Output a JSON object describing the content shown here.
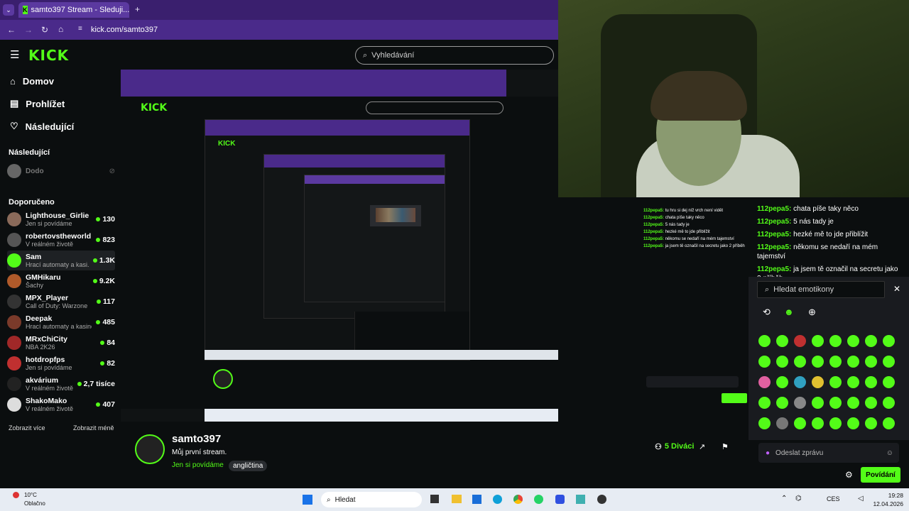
{
  "browser": {
    "tab_title": "samto397 Stream - Sleduji...",
    "url": "kick.com/samto397"
  },
  "header": {
    "logo": "KICK",
    "search_placeholder": "Vyhledávání"
  },
  "sidebar": {
    "nav": [
      {
        "label": "Domov",
        "icon": "home-icon"
      },
      {
        "label": "Prohlížet",
        "icon": "browse-icon"
      },
      {
        "label": "Následující",
        "icon": "heart-icon"
      }
    ],
    "following_title": "Následující",
    "following_item": "Dodo",
    "recommended_title": "Doporučeno",
    "recommended": [
      {
        "name": "Lighthouse_Girlie",
        "category": "Jen si povídáme",
        "viewers": "130"
      },
      {
        "name": "robertovstheworld",
        "category": "V reálném životě",
        "viewers": "823"
      },
      {
        "name": "Sam",
        "category": "Hrací automaty a kasi...",
        "viewers": "1.3K"
      },
      {
        "name": "GMHikaru",
        "category": "Šachy",
        "viewers": "9.2K"
      },
      {
        "name": "MPX_Player",
        "category": "Call of Duty: Warzone",
        "viewers": "117"
      },
      {
        "name": "Deepak",
        "category": "Hrací automaty a kasino",
        "viewers": "485"
      },
      {
        "name": "MRxChiCity",
        "category": "NBA 2K26",
        "viewers": "84"
      },
      {
        "name": "hotdropfps",
        "category": "Jen si povídáme",
        "viewers": "82"
      },
      {
        "name": "akvárium",
        "category": "V reálném životě",
        "viewers": "2,7 tisíce"
      },
      {
        "name": "ShakoMako",
        "category": "V reálném životě",
        "viewers": "407"
      }
    ],
    "show_more": "Zobrazit více",
    "show_less": "Zobrazit méně"
  },
  "stream": {
    "channel": "samto397",
    "title": "Můj první stream.",
    "category": "Jen si povídáme",
    "tag": "angličtina",
    "viewers": "5 Diváci"
  },
  "chat": {
    "messages": [
      {
        "user": "112pepa5",
        "text": "chata píše taky něco"
      },
      {
        "user": "112pepa5",
        "text": "5 nás tady je"
      },
      {
        "user": "112pepa5",
        "text": "hezké mě to jde přiblížit"
      },
      {
        "user": "112pepa5",
        "text": "někomu se nedaří na mém tajemství"
      },
      {
        "user": "112pepa5",
        "text": "ja jsem tě označil na secretu jako 2 příběh"
      }
    ],
    "emote_search_placeholder": "Hledat emotikony",
    "input_placeholder": "Odeslat zprávu",
    "send_label": "Povídání"
  },
  "taskbar": {
    "weather_temp": "10°C",
    "weather_text": "Oblačno",
    "search_label": "Hledat",
    "lang": "CES",
    "time": "19:28",
    "date": "12.04.2026"
  }
}
